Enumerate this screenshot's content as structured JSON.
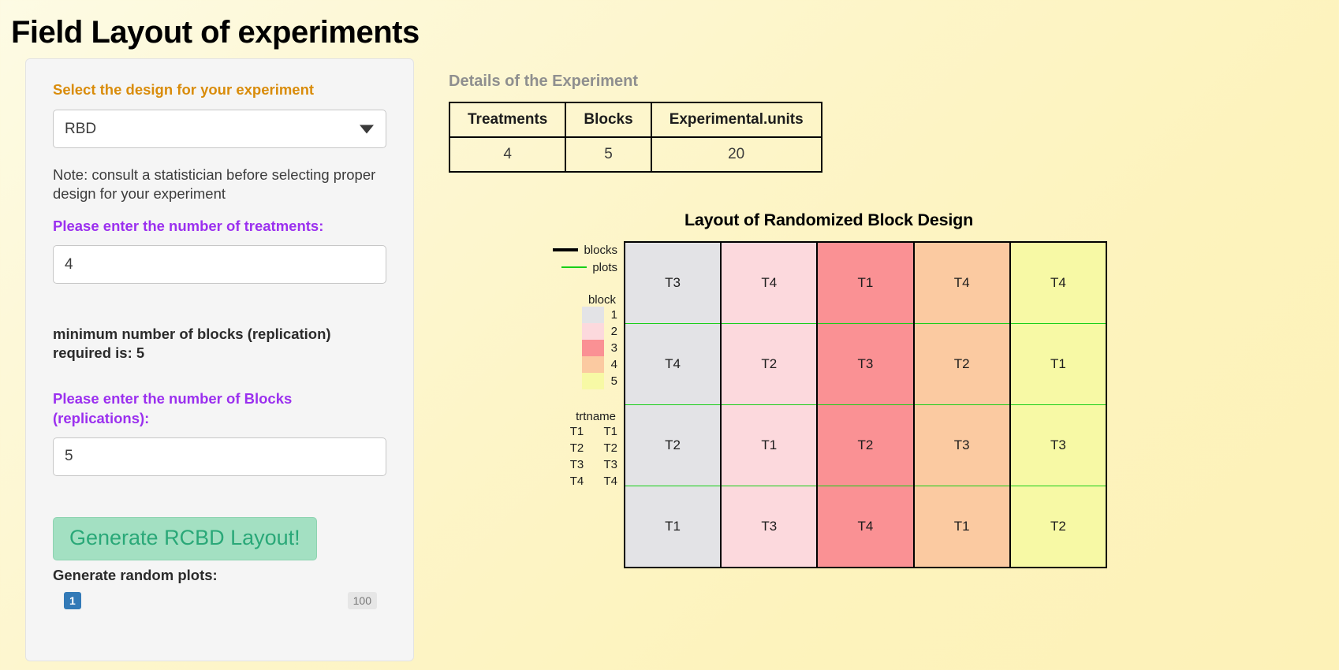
{
  "page_title": "Field Layout of experiments",
  "sidebar": {
    "design_label": "Select the design for your experiment",
    "design_value": "RBD",
    "design_options": [
      "RBD"
    ],
    "note": "Note: consult a statistician before selecting proper design for your experiment",
    "treatments_label": "Please enter the number of treatments:",
    "treatments_value": "4",
    "min_blocks_text": "minimum number of blocks (replication) required is: 5",
    "blocks_label": "Please enter the number of Blocks (replications):",
    "blocks_value": "5",
    "generate_button": "Generate RCBD Layout!",
    "random_plots_label": "Generate random plots:",
    "slider_value": "1",
    "slider_max": "100"
  },
  "main": {
    "details_heading": "Details of the Experiment",
    "details_table": {
      "headers": [
        "Treatments",
        "Blocks",
        "Experimental.units"
      ],
      "rows": [
        [
          "4",
          "5",
          "20"
        ]
      ]
    }
  },
  "chart_data": {
    "type": "heatmap",
    "title": "Layout of Randomized Block Design",
    "xlabel": "",
    "ylabel": "",
    "grid": {
      "n_blocks": 5,
      "n_plots": 4,
      "columns": [
        "1",
        "2",
        "3",
        "4",
        "5"
      ],
      "cells": [
        [
          "T3",
          "T4",
          "T1",
          "T4",
          "T4"
        ],
        [
          "T4",
          "T2",
          "T3",
          "T2",
          "T1"
        ],
        [
          "T2",
          "T1",
          "T2",
          "T3",
          "T3"
        ],
        [
          "T1",
          "T3",
          "T4",
          "T1",
          "T2"
        ]
      ]
    },
    "block_colors": [
      "#e3e3e6",
      "#fcd9dd",
      "#fa9194",
      "#fbcaa1",
      "#f7f9a5"
    ],
    "line_legend": {
      "entries": [
        {
          "label": "blocks",
          "color": "#000000"
        },
        {
          "label": "plots",
          "color": "#17cf17"
        }
      ]
    },
    "block_legend": {
      "title": "block",
      "entries": [
        {
          "label": "1",
          "color": "#e3e3e6"
        },
        {
          "label": "2",
          "color": "#fcd9dd"
        },
        {
          "label": "3",
          "color": "#fa9194"
        },
        {
          "label": "4",
          "color": "#fbcaa1"
        },
        {
          "label": "5",
          "color": "#f7f9a5"
        }
      ]
    },
    "trtname_legend": {
      "title": "trtname",
      "entries": [
        {
          "key": "T1",
          "label": "T1"
        },
        {
          "key": "T2",
          "label": "T2"
        },
        {
          "key": "T3",
          "label": "T3"
        },
        {
          "key": "T4",
          "label": "T4"
        }
      ]
    }
  }
}
